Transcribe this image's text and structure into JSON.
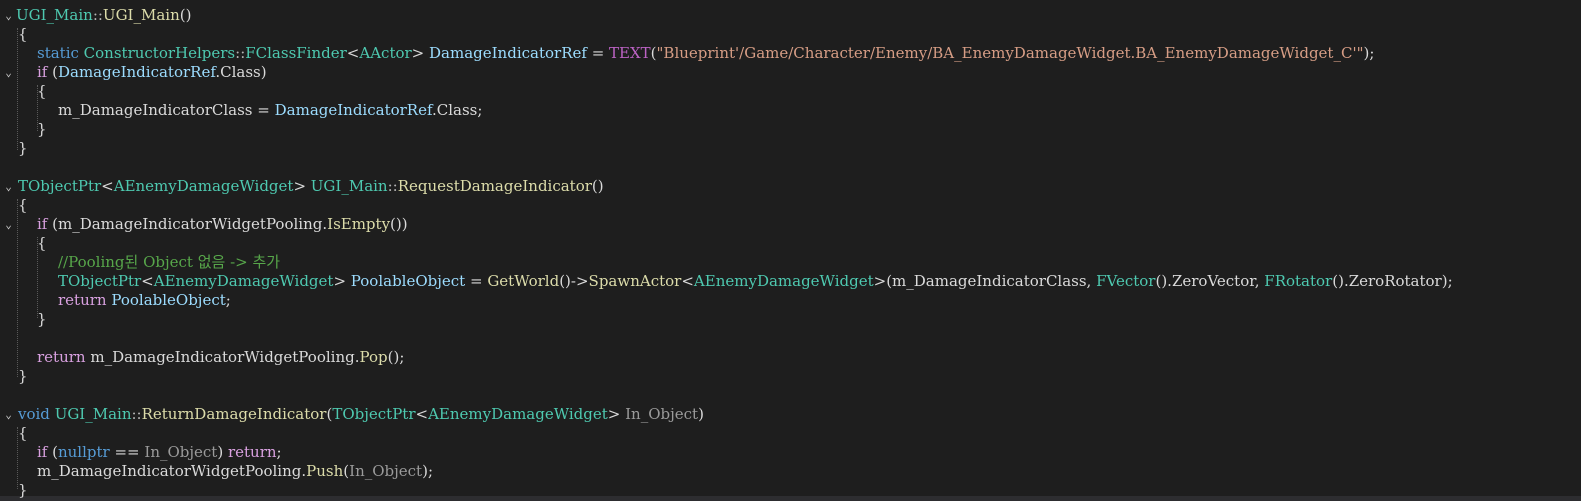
{
  "editor": {
    "colors": {
      "background": "#1e1e1e",
      "plain": "#dadada",
      "keyword": "#569cd6",
      "control": "#d8a0df",
      "type": "#4ec9b0",
      "function": "#dcdcaa",
      "variable": "#9cdcfe",
      "parameter": "#9a9a9a",
      "string": "#d69d85",
      "macro": "#bd63c5",
      "comment": "#57a64a"
    },
    "lines": [
      {
        "fold": "⌄",
        "tokens": [
          [
            "UGI_Main",
            "type"
          ],
          [
            "::",
            "punct"
          ],
          [
            "UGI_Main",
            "func"
          ],
          [
            "()",
            "plain"
          ]
        ]
      },
      {
        "fold": "",
        "tokens": [
          [
            "{",
            "plain"
          ]
        ]
      },
      {
        "fold": "",
        "tokens": [
          [
            "static ",
            "keyword"
          ],
          [
            "ConstructorHelpers",
            "type"
          ],
          [
            "::",
            "punct"
          ],
          [
            "FClassFinder",
            "type"
          ],
          [
            "<",
            "plain"
          ],
          [
            "AActor",
            "type"
          ],
          [
            "> ",
            "plain"
          ],
          [
            "DamageIndicatorRef",
            "var"
          ],
          [
            " = ",
            "plain"
          ],
          [
            "TEXT",
            "macro"
          ],
          [
            "(",
            "plain"
          ],
          [
            "\"Blueprint'/Game/Character/Enemy/BA_EnemyDamageWidget.BA_EnemyDamageWidget_C'\"",
            "string"
          ],
          [
            ");",
            "plain"
          ]
        ]
      },
      {
        "fold": "⌄",
        "tokens": [
          [
            "if ",
            "ctrl"
          ],
          [
            "(",
            "plain"
          ],
          [
            "DamageIndicatorRef",
            "var"
          ],
          [
            ".Class)",
            "plain"
          ]
        ]
      },
      {
        "fold": "",
        "tokens": [
          [
            "{",
            "plain"
          ]
        ]
      },
      {
        "fold": "",
        "tokens": [
          [
            "m_DamageIndicatorClass",
            "plain"
          ],
          [
            " = ",
            "plain"
          ],
          [
            "DamageIndicatorRef",
            "var"
          ],
          [
            ".Class;",
            "plain"
          ]
        ]
      },
      {
        "fold": "",
        "tokens": [
          [
            "}",
            "plain"
          ]
        ]
      },
      {
        "fold": "",
        "tokens": [
          [
            "}",
            "plain"
          ]
        ]
      },
      {
        "fold": "",
        "tokens": []
      },
      {
        "fold": "⌄",
        "tokens": [
          [
            "TObjectPtr",
            "type"
          ],
          [
            "<",
            "plain"
          ],
          [
            "AEnemyDamageWidget",
            "type"
          ],
          [
            "> ",
            "plain"
          ],
          [
            "UGI_Main",
            "type"
          ],
          [
            "::",
            "punct"
          ],
          [
            "RequestDamageIndicator",
            "func"
          ],
          [
            "()",
            "plain"
          ]
        ]
      },
      {
        "fold": "",
        "tokens": [
          [
            "{",
            "plain"
          ]
        ]
      },
      {
        "fold": "⌄",
        "tokens": [
          [
            "if ",
            "ctrl"
          ],
          [
            "(",
            "plain"
          ],
          [
            "m_DamageIndicatorWidgetPooling",
            "plain"
          ],
          [
            ".",
            "plain"
          ],
          [
            "IsEmpty",
            "func"
          ],
          [
            "())",
            "plain"
          ]
        ]
      },
      {
        "fold": "",
        "tokens": [
          [
            "{",
            "plain"
          ]
        ]
      },
      {
        "fold": "",
        "tokens": [
          [
            "//Pooling된 Object 없음 -> 추가",
            "comment"
          ]
        ]
      },
      {
        "fold": "",
        "tokens": [
          [
            "TObjectPtr",
            "type"
          ],
          [
            "<",
            "plain"
          ],
          [
            "AEnemyDamageWidget",
            "type"
          ],
          [
            "> ",
            "plain"
          ],
          [
            "PoolableObject",
            "var"
          ],
          [
            " = ",
            "plain"
          ],
          [
            "GetWorld",
            "func"
          ],
          [
            "()->",
            "plain"
          ],
          [
            "SpawnActor",
            "func"
          ],
          [
            "<",
            "plain"
          ],
          [
            "AEnemyDamageWidget",
            "type"
          ],
          [
            ">(m_DamageIndicatorClass, ",
            "plain"
          ],
          [
            "FVector",
            "type"
          ],
          [
            "().ZeroVector, ",
            "plain"
          ],
          [
            "FRotator",
            "type"
          ],
          [
            "().ZeroRotator);",
            "plain"
          ]
        ]
      },
      {
        "fold": "",
        "tokens": [
          [
            "return ",
            "ctrl"
          ],
          [
            "PoolableObject",
            "var"
          ],
          [
            ";",
            "plain"
          ]
        ]
      },
      {
        "fold": "",
        "tokens": [
          [
            "}",
            "plain"
          ]
        ]
      },
      {
        "fold": "",
        "tokens": []
      },
      {
        "fold": "",
        "tokens": [
          [
            "return ",
            "ctrl"
          ],
          [
            "m_DamageIndicatorWidgetPooling",
            "plain"
          ],
          [
            ".",
            "plain"
          ],
          [
            "Pop",
            "func"
          ],
          [
            "();",
            "plain"
          ]
        ]
      },
      {
        "fold": "",
        "tokens": [
          [
            "}",
            "plain"
          ]
        ]
      },
      {
        "fold": "",
        "tokens": []
      },
      {
        "fold": "⌄",
        "tokens": [
          [
            "void ",
            "keyword"
          ],
          [
            "UGI_Main",
            "type"
          ],
          [
            "::",
            "punct"
          ],
          [
            "ReturnDamageIndicator",
            "func"
          ],
          [
            "(",
            "plain"
          ],
          [
            "TObjectPtr",
            "type"
          ],
          [
            "<",
            "plain"
          ],
          [
            "AEnemyDamageWidget",
            "type"
          ],
          [
            "> ",
            "plain"
          ],
          [
            "In_Object",
            "param"
          ],
          [
            ")",
            "plain"
          ]
        ]
      },
      {
        "fold": "",
        "tokens": [
          [
            "{",
            "plain"
          ]
        ]
      },
      {
        "fold": "",
        "tokens": [
          [
            "if ",
            "ctrl"
          ],
          [
            "(",
            "plain"
          ],
          [
            "nullptr",
            "keyword"
          ],
          [
            " == ",
            "plain"
          ],
          [
            "In_Object",
            "param"
          ],
          [
            ") ",
            "plain"
          ],
          [
            "return",
            "ctrl"
          ],
          [
            ";",
            "plain"
          ]
        ]
      },
      {
        "fold": "",
        "tokens": [
          [
            "m_DamageIndicatorWidgetPooling",
            "plain"
          ],
          [
            ".",
            "plain"
          ],
          [
            "Push",
            "func"
          ],
          [
            "(",
            "plain"
          ],
          [
            "In_Object",
            "param"
          ],
          [
            ");",
            "plain"
          ]
        ]
      },
      {
        "fold": "",
        "tokens": [
          [
            "}",
            "plain"
          ]
        ]
      }
    ]
  }
}
